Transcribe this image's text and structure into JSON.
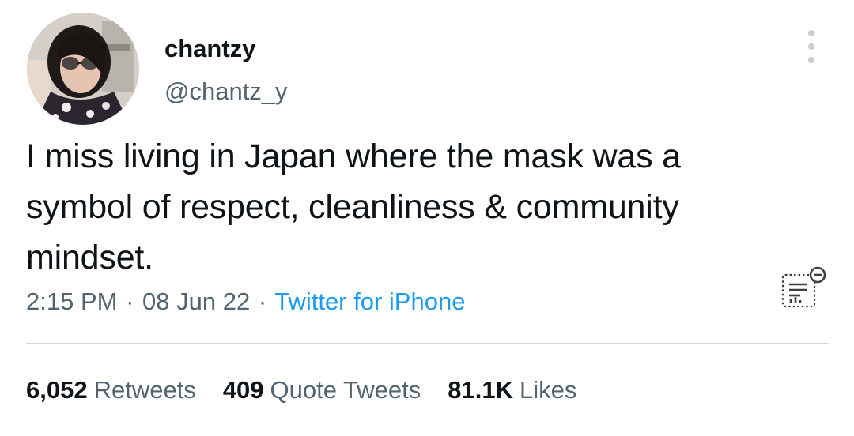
{
  "author": {
    "display_name": "chantzy",
    "handle": "@chantz_y"
  },
  "tweet": {
    "text": "I miss living in Japan where the mask was a symbol of respect, cleanliness & community mindset.",
    "time": "2:15 PM",
    "date": "08 Jun 22",
    "separator": "·",
    "source": "Twitter for iPhone"
  },
  "stats": {
    "retweets_count": "6,052",
    "retweets_label": "Retweets",
    "quotes_count": "409",
    "quotes_label": "Quote Tweets",
    "likes_count": "81.1K",
    "likes_label": "Likes"
  },
  "icons": {
    "more": "more-dots-icon",
    "analytics": "analytics-icon"
  },
  "colors": {
    "link": "#1d9bf0",
    "secondary_text": "#536471",
    "primary_text": "#0f1419"
  }
}
